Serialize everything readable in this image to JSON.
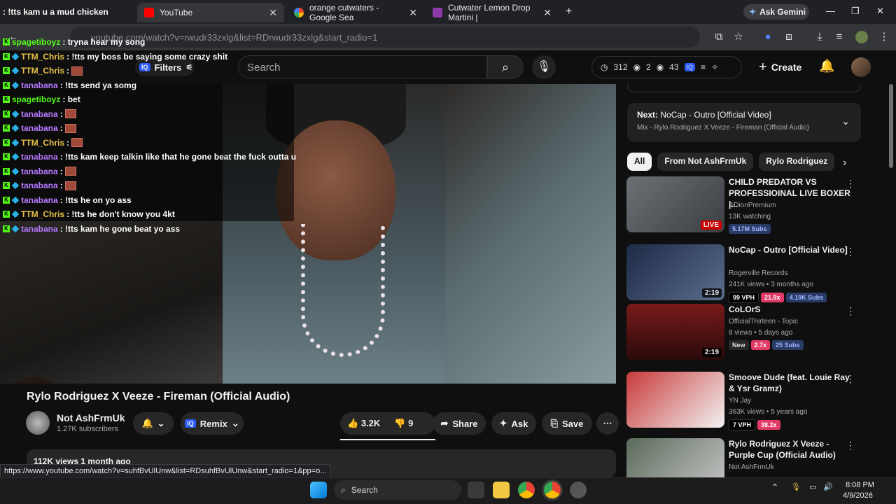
{
  "tabs": [
    {
      "label": "YouTube",
      "active": true
    },
    {
      "label": "orange cutwaters - Google Sea"
    },
    {
      "label": "Cutwater Lemon Drop Martini |"
    }
  ],
  "browser": {
    "url": "youtube.com/watch?v=rwudr33zxlg&list=RDrwudr33zxlg&start_radio=1",
    "ask_gemini": "Ask Gemini"
  },
  "header": {
    "logo": "YouTube",
    "filters": "Filters",
    "search_placeholder": "Search",
    "stats": {
      "s1": "312",
      "s2": "2",
      "s3": "43"
    },
    "create": "Create"
  },
  "chat": [
    {
      "user": "spagetiboyz",
      "text": ": tryna hear my song",
      "color": "#53fc18"
    },
    {
      "user": "TTM_Chris",
      "text": ": !tts my boss be saying some crazy shit",
      "color": "#e7c14a"
    },
    {
      "user": "TTM_Chris",
      "text": ":",
      "emote": true,
      "color": "#e7c14a"
    },
    {
      "user": "tanabana",
      "text": ": !tts send ya somg",
      "color": "#b77aff"
    },
    {
      "user": "spagetiboyz",
      "text": ": bet",
      "color": "#53fc18"
    },
    {
      "user": "tanabana",
      "text": ":",
      "emote": true,
      "color": "#b77aff"
    },
    {
      "user": "tanabana",
      "text": ":",
      "emote": true,
      "color": "#b77aff"
    },
    {
      "user": "TTM_Chris",
      "text": ":",
      "emote": true,
      "color": "#e7c14a"
    },
    {
      "user": "tanabana",
      "text": ": !tts kam keep talkin like that he gone beat the fuck outta u",
      "color": "#b77aff"
    },
    {
      "user": "tanabana",
      "text": ":",
      "emote": true,
      "color": "#b77aff"
    },
    {
      "user": "tanabana",
      "text": ":",
      "emote": true,
      "color": "#b77aff"
    },
    {
      "user": "tanabana",
      "text": ": !tts he on yo ass",
      "color": "#b77aff"
    },
    {
      "user": "TTM_Chris",
      "text": ": !tts he don't know you 4kt",
      "color": "#e7c14a"
    },
    {
      "user": "tanabana",
      "text": ": !tts kam he gone beat yo ass",
      "color": "#b77aff"
    }
  ],
  "chat_top_overlay": ": !tts kam u a mud chicken",
  "video": {
    "title": "Rylo Rodriguez X Veeze - Fireman (Official Audio)",
    "channel": "Not AshFrmUk",
    "subs": "1.27K subscribers",
    "remix": "Remix",
    "likes": "3.2K",
    "dislikes": "9",
    "share": "Share",
    "ask": "Ask",
    "save": "Save",
    "views": "112K views  1 month ago"
  },
  "status_url": "https://www.youtube.com/watch?v=suhfBvUlUnw&list=RDsuhfBvUlUnw&start_radio=1&pp=o...",
  "upnext": {
    "label": "Next:",
    "title": "NoCap - Outro [Official Video]",
    "sub": "Mix - Rylo Rodriguez X Veeze - Fireman (Official Audio)"
  },
  "chips": [
    "All",
    "From Not AshFrmUk",
    "Rylo Rodriguez"
  ],
  "recs": [
    {
      "title": "CHILD PREDATOR VS PROFESSIOINAL LIVE BOXER |...",
      "channel": "JiDionPremium",
      "meta": "13K watching",
      "badge": "LIVE",
      "tags": [
        "5.17M Subs"
      ]
    },
    {
      "title": "NoCap - Outro [Official Video]",
      "channel": "Rogerville Records",
      "meta": "241K views • 3 months ago",
      "badge": "2:19",
      "tags": [
        "99 VPH",
        "21.9x",
        "4.19K Subs"
      ]
    },
    {
      "title": "CoLOrS",
      "channel": "OfficialThirteen - Topic",
      "meta": "8 views • 5 days ago",
      "badge": "2:19",
      "tags": [
        "New",
        "2.7x",
        "25 Subs"
      ]
    },
    {
      "title": "Smoove Dude (feat. Louie Ray & Ysr Gramz)",
      "channel": "YN Jay",
      "meta": "363K views • 5 years ago",
      "badge": "",
      "tags": [
        "7 VPH",
        "38.2x"
      ]
    },
    {
      "title": "Rylo Rodriguez X Veeze - Purple Cup (Official Audio)",
      "channel": "Not AshFrmUk",
      "meta": "",
      "badge": "",
      "tags": []
    }
  ],
  "taskbar": {
    "search": "Search",
    "time": "8:08 PM",
    "date": "4/9/2026"
  }
}
